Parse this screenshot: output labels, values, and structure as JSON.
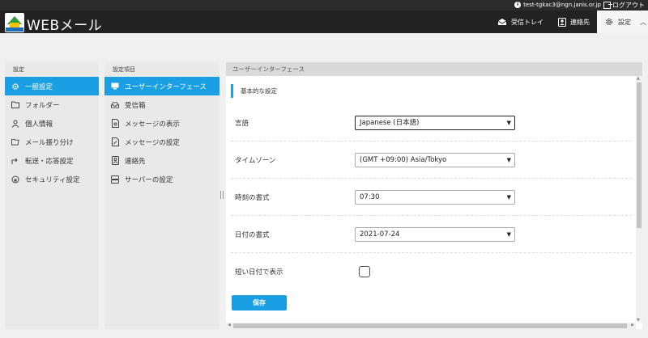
{
  "topbar": {
    "user_email": "test-tgkac3@ngn.janis.or.jp",
    "logout_label": "ログアウト"
  },
  "header": {
    "logo_text": "JANIS",
    "app_title": "WEBメール",
    "nav": [
      {
        "label": "受信トレイ",
        "icon": "envelope-icon"
      },
      {
        "label": "連絡先",
        "icon": "contact-icon"
      },
      {
        "label": "設定",
        "icon": "gear-icon"
      }
    ]
  },
  "panel1": {
    "title": "設定",
    "items": [
      {
        "label": "一般設定",
        "icon": "gear-icon",
        "active": true
      },
      {
        "label": "フォルダー",
        "icon": "folder-icon"
      },
      {
        "label": "個人情報",
        "icon": "person-icon"
      },
      {
        "label": "メール振り分け",
        "icon": "folder-filter-icon"
      },
      {
        "label": "転送・応答設定",
        "icon": "forward-icon"
      },
      {
        "label": "セキュリティ設定",
        "icon": "security-icon"
      }
    ]
  },
  "panel2": {
    "title": "設定項目",
    "items": [
      {
        "label": "ユーザーインターフェース",
        "icon": "monitor-icon",
        "active": true
      },
      {
        "label": "受信箱",
        "icon": "inbox-icon"
      },
      {
        "label": "メッセージの表示",
        "icon": "document-view-icon"
      },
      {
        "label": "メッセージの設定",
        "icon": "document-edit-icon"
      },
      {
        "label": "連絡先",
        "icon": "contact-icon"
      },
      {
        "label": "サーバーの設定",
        "icon": "server-icon"
      }
    ]
  },
  "content": {
    "header": "ユーザーインターフェース",
    "section_title": "基本的な設定",
    "rows": [
      {
        "label": "言語",
        "value": "Japanese (日本語)"
      },
      {
        "label": "タイムゾーン",
        "value": "(GMT +09:00) Asia/Tokyo"
      },
      {
        "label": "時刻の書式",
        "value": "07:30"
      },
      {
        "label": "日付の書式",
        "value": "2021-07-24"
      }
    ],
    "checkbox_row": {
      "label": "短い日付で表示",
      "checked": false
    },
    "save_label": "保存"
  },
  "colors": {
    "accent": "#1a9ee4",
    "header_bg": "#222222",
    "panel_bg": "#e9e9e9"
  }
}
